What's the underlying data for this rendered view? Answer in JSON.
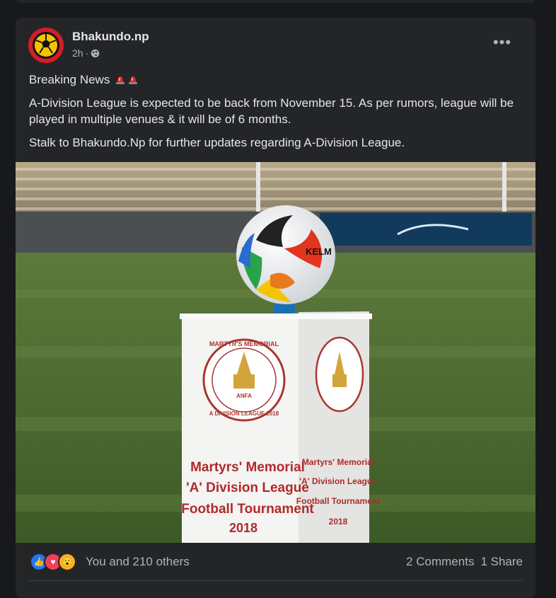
{
  "post": {
    "page_name": "Bhakundo.np",
    "time": "2h",
    "dot": "·",
    "more_label": "•••",
    "headline": "Breaking News",
    "paragraph1": "A-Division League is expected to be back from November 15. As per rumors, league will be played in multiple venues & it will be of 6 months.",
    "paragraph2": "Stalk to Bhakundo.Np for further updates regarding A-Division League."
  },
  "photo": {
    "ball_brand": "KELM",
    "emblem_top_text": "MARTYR'S MEMORIAL",
    "emblem_bottom_text": "A DIVISION LEAGUE 2018",
    "emblem_center": "ANFA",
    "caption_line1": "Martyrs' Memorial",
    "caption_line2": "'A' Division League",
    "caption_line3": "Football Tournament",
    "caption_line4": "2018",
    "side_line1": "Martyrs' Memorial",
    "side_line2": "'A' Division League",
    "side_line3": "Football Tournament",
    "side_line4": "2018"
  },
  "footer": {
    "reactions_text": "You and 210 others",
    "comments": "2 Comments",
    "shares": "1 Share",
    "reaction_icons": [
      "like-icon",
      "love-icon",
      "wow-icon"
    ]
  },
  "colors": {
    "background": "#18191a",
    "card": "#242526",
    "text": "#e4e6eb",
    "muted": "#b0b3b8",
    "like": "#2078f4",
    "love": "#f33e58",
    "wow": "#f7b125",
    "caption_red": "#b02a2a"
  }
}
